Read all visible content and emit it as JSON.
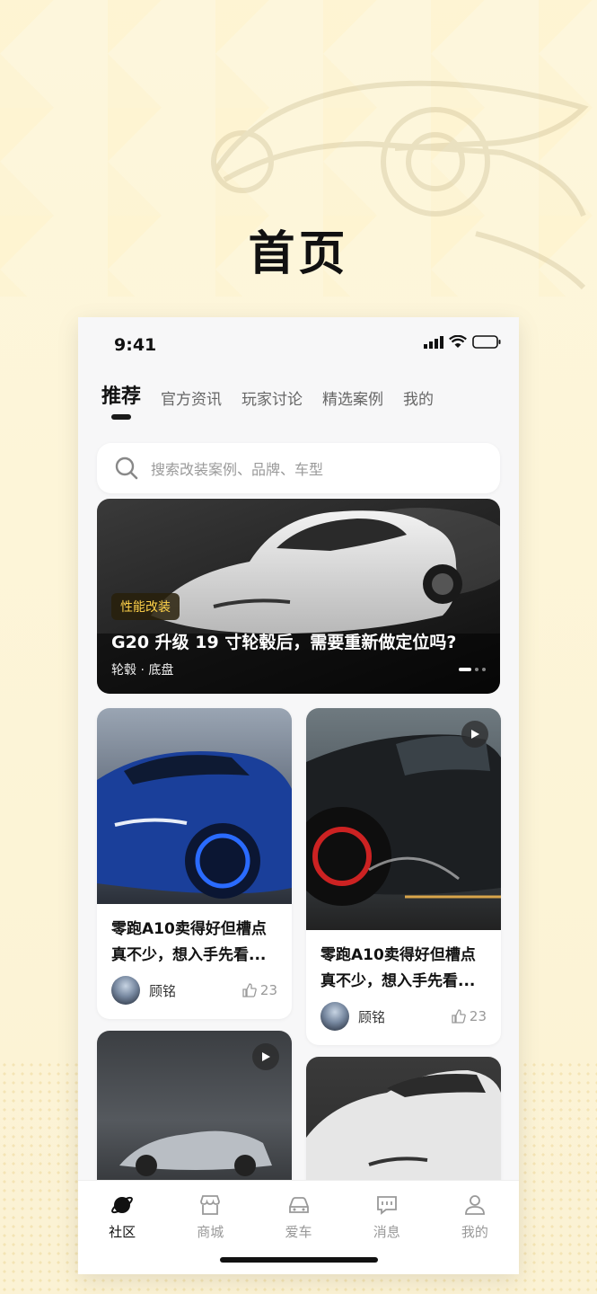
{
  "page_title": "首页",
  "status": {
    "time": "9:41"
  },
  "tabs": [
    {
      "label": "推荐",
      "active": true
    },
    {
      "label": "官方资讯"
    },
    {
      "label": "玩家讨论"
    },
    {
      "label": "精选案例"
    },
    {
      "label": "我的"
    }
  ],
  "search": {
    "placeholder": "搜索改装案例、品牌、车型"
  },
  "banner": {
    "tag": "性能改装",
    "title": "G20 升级 19 寸轮毂后，需要重新做定位吗?",
    "subtitle": "轮毂 · 底盘"
  },
  "posts": [
    {
      "title": "零跑A10卖得好但槽点真不少，想入手先看...",
      "author": "顾铭",
      "likes": "23",
      "video": false
    },
    {
      "title": "零跑A10卖得好但槽点真不少，想入手先看...",
      "author": "顾铭",
      "likes": "23",
      "video": true
    },
    {
      "video": true
    },
    {
      "video": false
    }
  ],
  "tabbar": [
    {
      "label": "社区",
      "icon": "planet-icon",
      "active": true
    },
    {
      "label": "商城",
      "icon": "store-icon"
    },
    {
      "label": "爱车",
      "icon": "car-icon"
    },
    {
      "label": "消息",
      "icon": "message-icon"
    },
    {
      "label": "我的",
      "icon": "user-icon"
    }
  ],
  "colors": {
    "accent": "#ffd24a",
    "text": "#111111",
    "muted": "#999999",
    "background": "#fdf6dc"
  }
}
